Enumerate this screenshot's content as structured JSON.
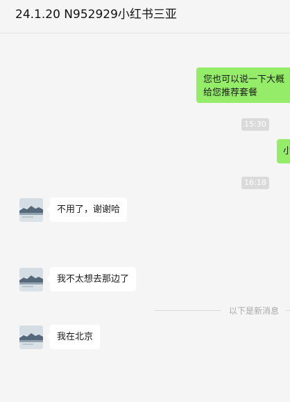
{
  "chat": {
    "title": "24.1.20 N952929小红书三亚"
  },
  "messages": {
    "m1_line1": "您也可以说一下大概",
    "m1_line2": "给您推荐套餐",
    "ts1": "15:30",
    "m2_text": "小",
    "ts2": "16:18",
    "m3_text": "不用了，谢谢哈",
    "m4_text": "我不太想去那边了",
    "new_divider": "以下是新消息",
    "m5_text": "我在北京"
  },
  "colors": {
    "outgoing_bubble": "#95ec69",
    "incoming_bubble": "#ffffff",
    "background": "#f5f5f5"
  }
}
